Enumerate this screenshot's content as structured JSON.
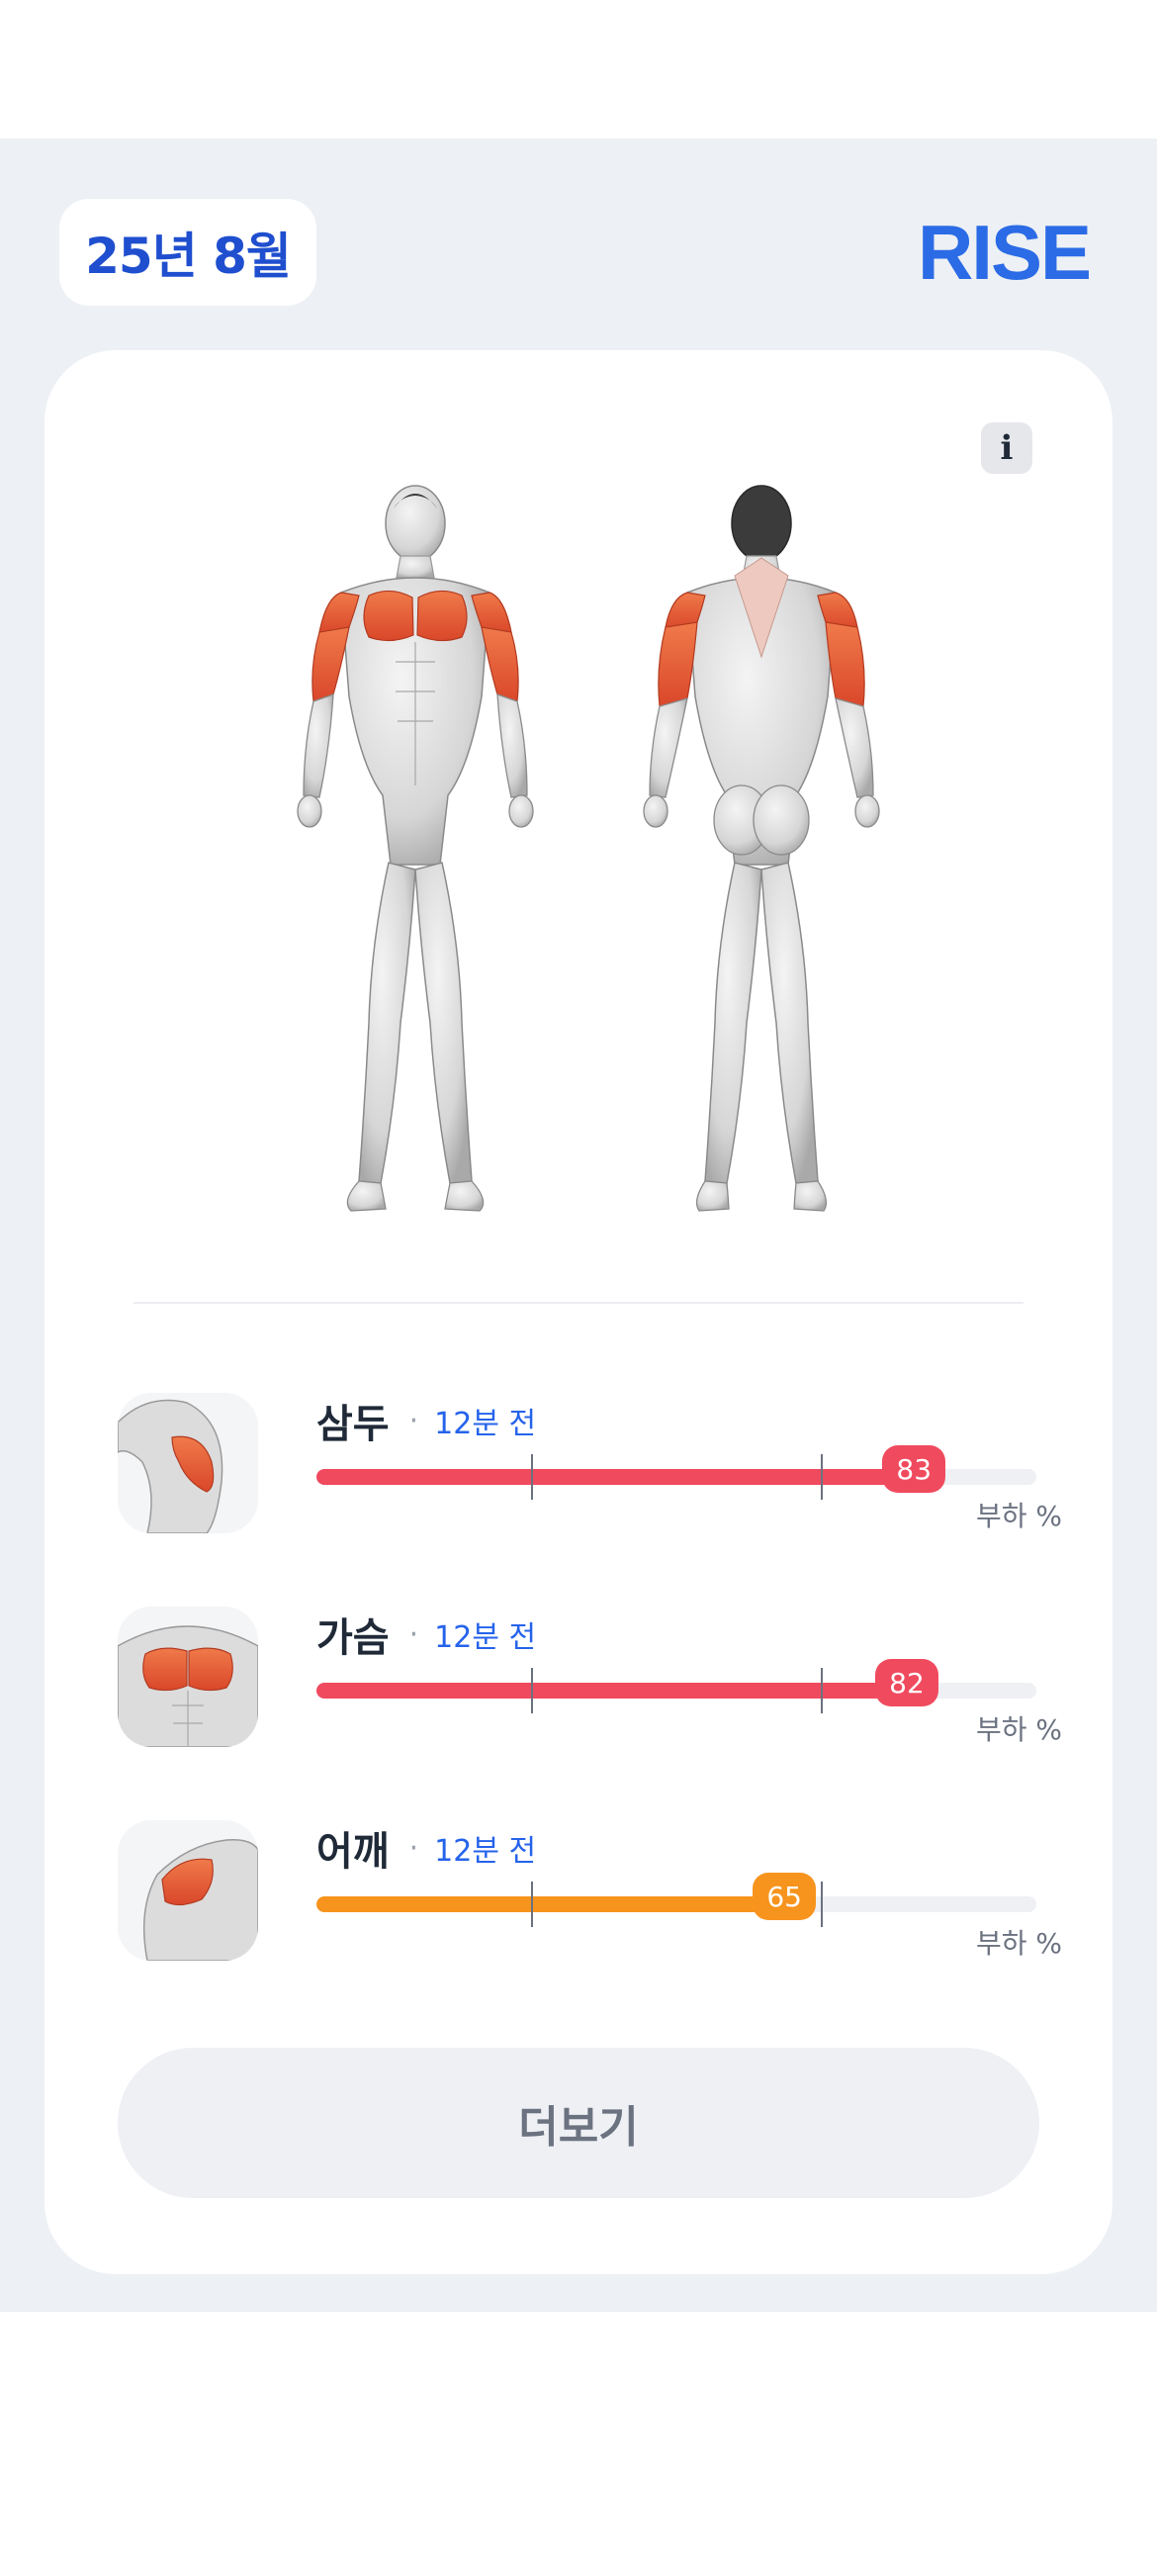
{
  "header": {
    "date_label": "25년 8월",
    "brand": "RISE"
  },
  "card": {
    "info_label": "i",
    "muscles": [
      {
        "name": "삼두",
        "time": "12분 전",
        "load": 83,
        "load_label": "83",
        "unit_label": "부하 %",
        "color": "#f04a5e",
        "thumb_icon": "triceps-thumbnail-icon"
      },
      {
        "name": "가슴",
        "time": "12분 전",
        "load": 82,
        "load_label": "82",
        "unit_label": "부하 %",
        "color": "#f04a5e",
        "thumb_icon": "chest-thumbnail-icon"
      },
      {
        "name": "어깨",
        "time": "12분 전",
        "load": 65,
        "load_label": "65",
        "unit_label": "부하 %",
        "color": "#f7941d",
        "thumb_icon": "shoulder-thumbnail-icon"
      }
    ],
    "more_button": "더보기"
  },
  "colors": {
    "accent_blue": "#2b6be6",
    "high_load": "#f04a5e",
    "medium_load": "#f7941d",
    "panel_bg": "#edf0f4"
  }
}
